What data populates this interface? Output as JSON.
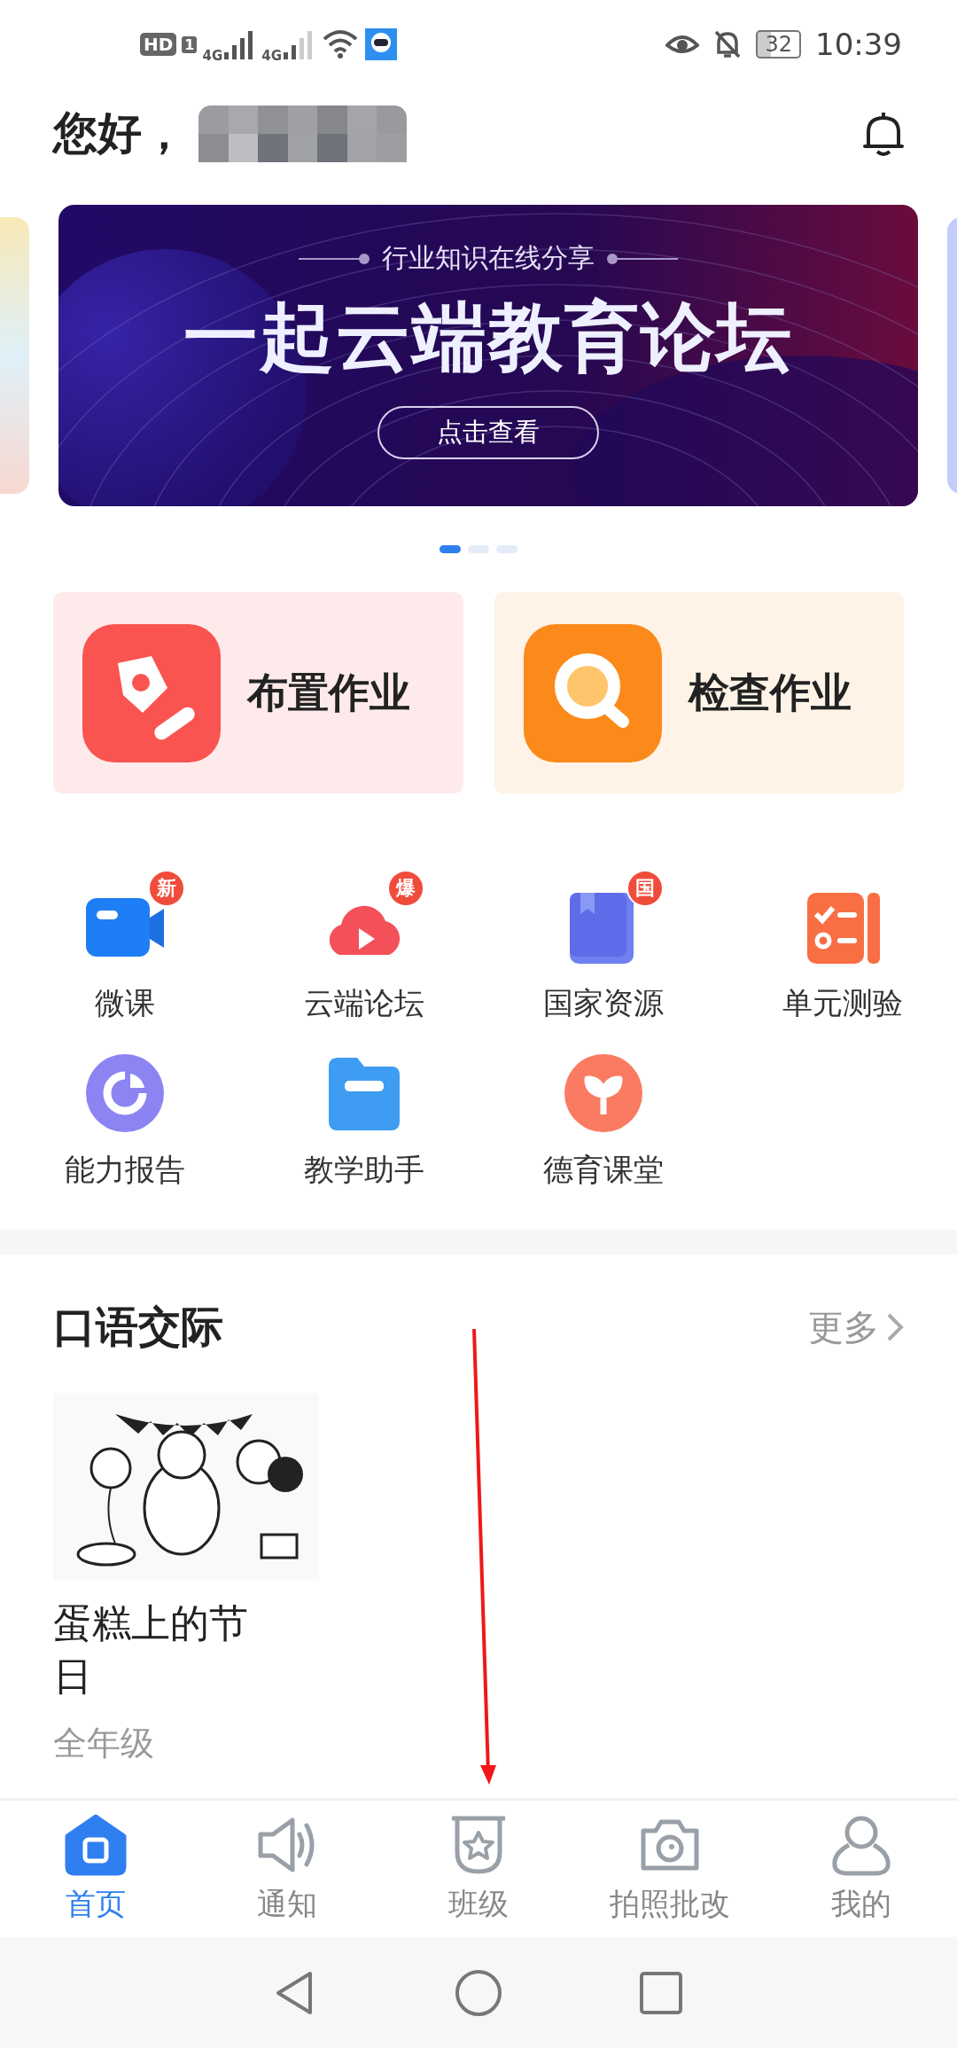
{
  "status_bar": {
    "hd": "HD",
    "sim": "1",
    "networks": [
      "4G",
      "4G"
    ],
    "battery": "32",
    "time": "10:39"
  },
  "greeting": "您好，",
  "banner": {
    "subtitle": "行业知识在线分享",
    "title": "一起云端教育论坛",
    "button": "点击查看"
  },
  "carousel_dots": [
    {
      "selected": true
    },
    {
      "selected": false
    },
    {
      "selected": false
    }
  ],
  "actions": [
    {
      "label": "布置作业",
      "kind": "assign"
    },
    {
      "label": "检查作业",
      "kind": "check"
    }
  ],
  "tools": [
    {
      "label": "微课",
      "kind": "video",
      "badge": "新"
    },
    {
      "label": "云端论坛",
      "kind": "cloud",
      "badge": "爆"
    },
    {
      "label": "国家资源",
      "kind": "book",
      "badge": "国"
    },
    {
      "label": "单元测验",
      "kind": "checklist"
    },
    {
      "label": "能力报告",
      "kind": "pie"
    },
    {
      "label": "教学助手",
      "kind": "folder"
    },
    {
      "label": "德育课堂",
      "kind": "sprout"
    }
  ],
  "section": {
    "title": "口语交际",
    "more": "更多",
    "items": [
      {
        "kind": "picture",
        "title": "蛋糕上的节日",
        "grade": "全年级"
      }
    ]
  },
  "tabs": [
    {
      "label": "首页",
      "kind": "home",
      "selected": true
    },
    {
      "label": "通知",
      "kind": "speaker",
      "selected": false
    },
    {
      "label": "班级",
      "kind": "class",
      "selected": false
    },
    {
      "label": "拍照批改",
      "kind": "camera",
      "selected": false
    },
    {
      "label": "我的",
      "kind": "person",
      "selected": false
    }
  ]
}
